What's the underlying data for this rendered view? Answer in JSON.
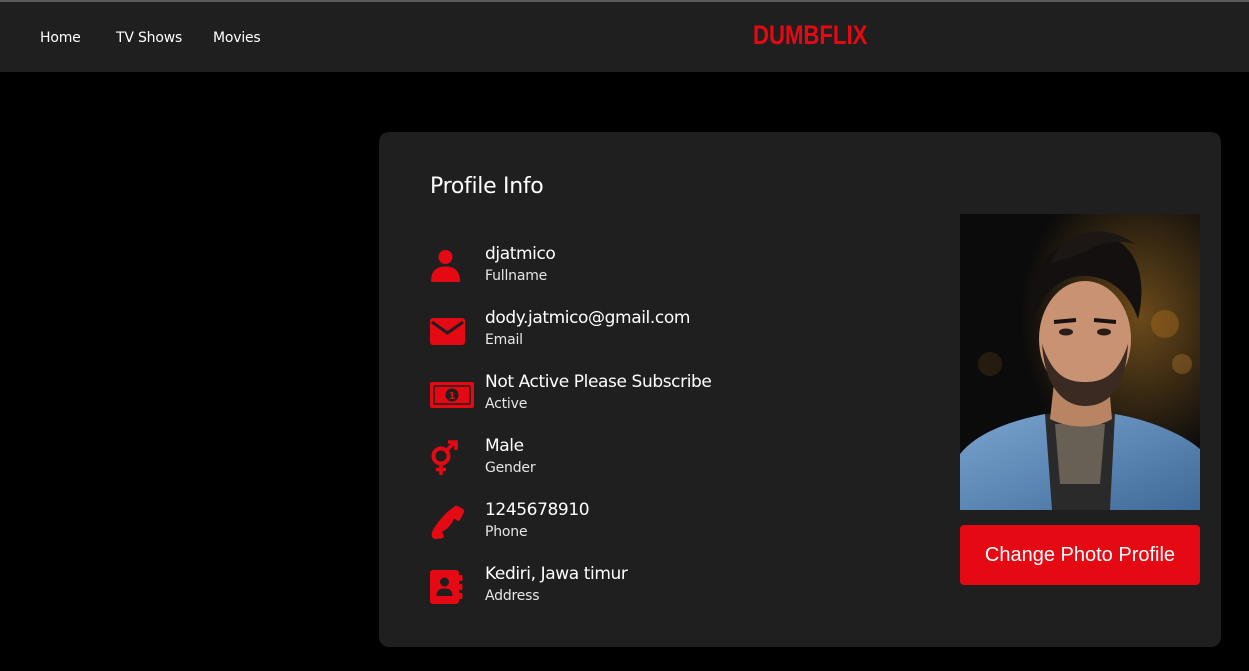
{
  "nav": {
    "links": [
      "Home",
      "TV Shows",
      "Movies"
    ],
    "logo": "DUMBFLIX"
  },
  "profile": {
    "title": "Profile Info",
    "rows": [
      {
        "icon": "user-icon",
        "value": "djatmico",
        "label": "Fullname"
      },
      {
        "icon": "envelope-icon",
        "value": "dody.jatmico@gmail.com",
        "label": "Email"
      },
      {
        "icon": "money-bill-icon",
        "value": "Not Active Please Subscribe",
        "label": "Active"
      },
      {
        "icon": "gender-icon",
        "value": "Male",
        "label": "Gender"
      },
      {
        "icon": "phone-icon",
        "value": "1245678910",
        "label": "Phone"
      },
      {
        "icon": "address-book-icon",
        "value": "Kediri, Jawa timur",
        "label": "Address"
      }
    ],
    "change_photo_label": "Change Photo Profile"
  },
  "colors": {
    "accent": "#e50914",
    "navbar": "#1f1f1f",
    "card": "#1f1f1f",
    "background": "#000000"
  }
}
